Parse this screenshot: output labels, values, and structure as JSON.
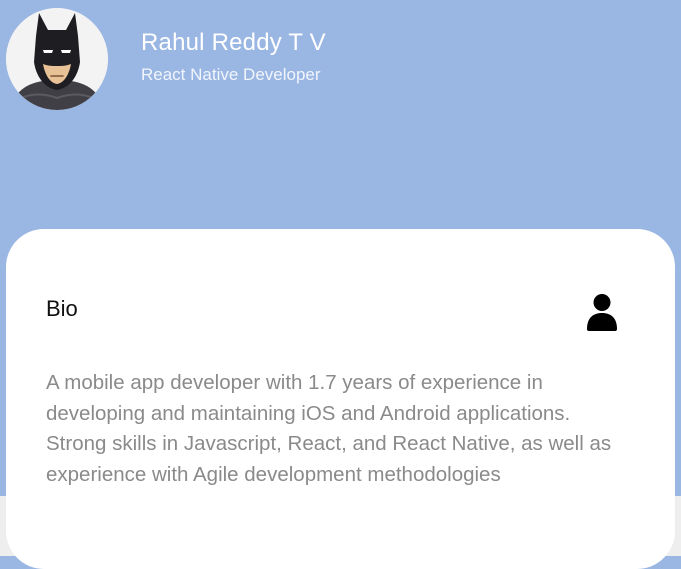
{
  "profile": {
    "name": "Rahul Reddy T V",
    "role": "React Native Developer"
  },
  "bio": {
    "title": "Bio",
    "icon": "user-icon",
    "text": "A mobile app developer with 1.7 years of experience in developing and maintaining iOS and Android applications. Strong skills in Javascript, React, and React Native, as well as experience with Agile development methodologies"
  },
  "colors": {
    "header_background": "#9ab6e2",
    "card_background": "#ffffff",
    "bio_text": "#8a8a8a"
  }
}
